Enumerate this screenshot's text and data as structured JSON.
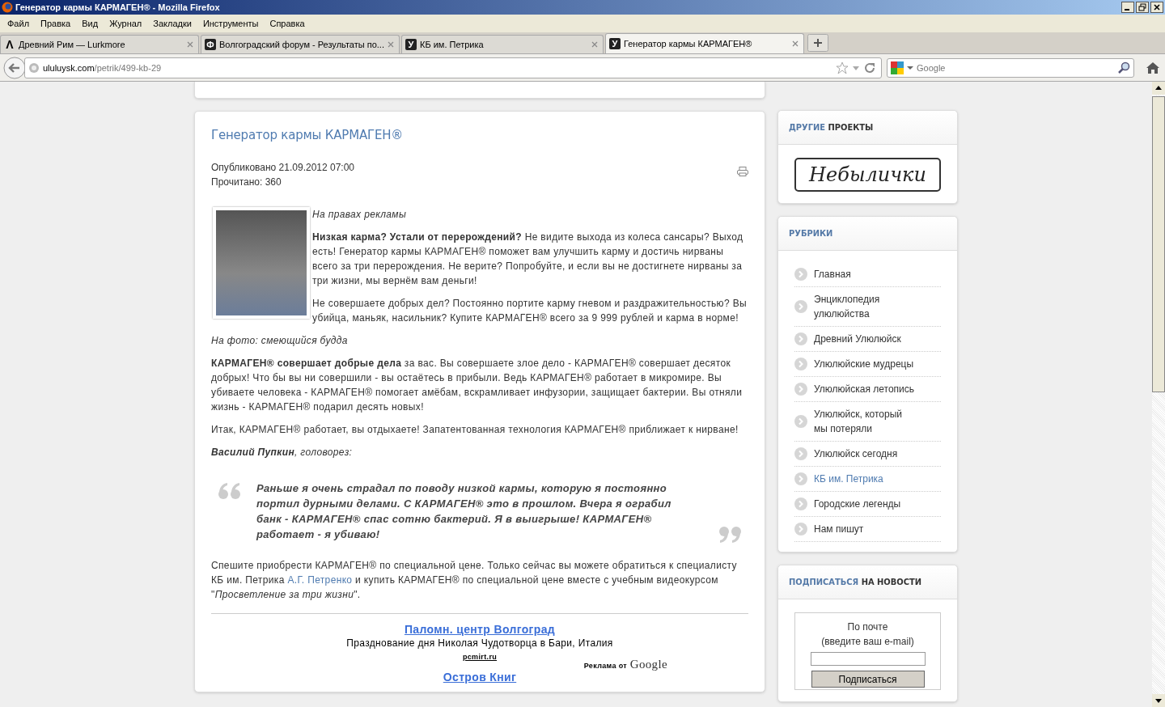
{
  "window": {
    "title": "Генератор кармы КАРМАГЕН® - Mozilla Firefox"
  },
  "menu": [
    "Файл",
    "Правка",
    "Вид",
    "Журнал",
    "Закладки",
    "Инструменты",
    "Справка"
  ],
  "tabs": [
    {
      "favicon": "Λ",
      "label": "Древний Рим — Lurkmore",
      "selected": false
    },
    {
      "favicon": "Ф",
      "label": "Волгоградский форум - Результаты по...",
      "selected": false
    },
    {
      "favicon": "У",
      "label": "КБ им. Петрика",
      "selected": false
    },
    {
      "favicon": "У",
      "label": "Генератор кармы КАРМАГЕН®",
      "selected": true
    }
  ],
  "address": {
    "host": "ululuysk.com",
    "path": "/petrik/499-kb-29"
  },
  "search": {
    "placeholder": "Google"
  },
  "article": {
    "title": "Генератор кармы КАРМАГЕН®",
    "published": "Опубликовано 21.09.2012 07:00",
    "views": "Прочитано: 360",
    "ad_note": "На правах рекламы",
    "paragraphs": [
      "**Низкая карма? Устали от перерождений?** Не видите выхода из колеса сансары? Выход есть! Генератор кармы КАРМАГЕН® поможет вам улучшить карму и достичь нирваны всего за три перерождения. Не верите? Попробуйте, и если вы не достигнете нирваны за три жизни, мы вернём вам деньги!",
      "Не совершаете добрых дел? Постоянно портите карму гневом и раздражительностью? Вы убийца, маньяк, насильник? Купите КАРМАГЕН® всего за 9 999 рублей и карма в норме!"
    ],
    "caption": "На фото: смеющийся будда",
    "body": [
      "**КАРМАГЕН® совершает добрые дела** за вас. Вы совершаете злое дело - КАРМАГЕН® совершает десяток добрых! Что бы вы ни совершили - вы остаётесь в прибыли. Ведь КАРМАГЕН® работает в микромире. Вы убиваете человека - КАРМАГЕН® помогает амёбам, вскрамливает инфузории, защищает бактерии. Вы отняли жизнь - КАРМАГЕН® подарил десять новых!",
      "Итак, КАРМАГЕН® работает, вы отдыхаете! Запатентованная технология КАРМАГЕН® приближает к нирване!"
    ],
    "quote_author": "**Василий Пупкин**, головорез:",
    "quote": "Раньше я очень страдал по поводу низкой кармы, которую я постоянно портил дурными делами. С КАРМАГЕН® это в прошлом. Вчера я ограбил банк - КАРМАГЕН® спас сотню бактерий. Я в выигрыше! КАРМАГЕН® работает - я убиваю!",
    "closing": {
      "before": "Спешите приобрести КАРМАГЕН® по специальной цене. Только сейчас вы можете обратиться к специалисту КБ им. Петрика",
      "link": "А.Г. Петренко",
      "after": "и купить КАРМАГЕН® по специальной цене вместе с учебным видеокурсом \"*Просветление за три жизни*\"."
    }
  },
  "ads": [
    {
      "title": "Паломн. центр Волгоград",
      "description": "Празднование дня Николая Чудотворца в Бари, Италия",
      "url": "pcmirt.ru"
    },
    {
      "title": "Остров Книг"
    }
  ],
  "ads_by": {
    "label": "Реклама от",
    "brand": "Google"
  },
  "sidebar": {
    "projects": {
      "heading_accent": "ДРУГИЕ",
      "heading_rest": "ПРОЕКТЫ",
      "banner": "Небылички"
    },
    "rubrics": {
      "heading_accent": "РУБРИКИ",
      "items": [
        {
          "label": "Главная",
          "selected": false
        },
        {
          "label": "Энциклопедия улюлюйства",
          "selected": false
        },
        {
          "label": "Древний Улюлюйск",
          "selected": false
        },
        {
          "label": "Улюлюйские мудрецы",
          "selected": false
        },
        {
          "label": "Улюлюйская летопись",
          "selected": false
        },
        {
          "label": "Улюлюйск, который мы потеряли",
          "selected": false
        },
        {
          "label": "Улюлюйск сегодня",
          "selected": false
        },
        {
          "label": "КБ им. Петрика",
          "selected": true
        },
        {
          "label": "Городские легенды",
          "selected": false
        },
        {
          "label": "Нам пишут",
          "selected": false
        }
      ]
    },
    "subscribe": {
      "heading_accent": "ПОДПИСАТЬСЯ",
      "heading_rest": "НА НОВОСТИ",
      "lines": [
        "По почте",
        "(введите ваш e-mail)"
      ],
      "button": "Подписаться"
    }
  }
}
